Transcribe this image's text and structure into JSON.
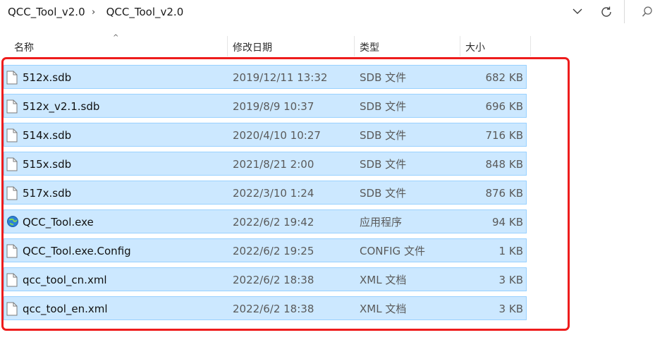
{
  "breadcrumb": {
    "items": [
      "QCC_Tool_v2.0",
      "QCC_Tool_v2.0"
    ],
    "separator": "›"
  },
  "toolbar": {
    "dropdown_icon": "chevron-down-icon",
    "refresh_icon": "refresh-icon",
    "search_icon": "search-icon"
  },
  "columns": {
    "name": "名称",
    "date": "修改日期",
    "type": "类型",
    "size": "大小",
    "sort_indicator": "^"
  },
  "files": [
    {
      "name": "512x.sdb",
      "date": "2019/12/11 13:32",
      "type": "SDB 文件",
      "size": "682 KB",
      "icon": "file-icon"
    },
    {
      "name": "512x_v2.1.sdb",
      "date": "2019/8/9 10:37",
      "type": "SDB 文件",
      "size": "696 KB",
      "icon": "file-icon"
    },
    {
      "name": "514x.sdb",
      "date": "2020/4/10 10:27",
      "type": "SDB 文件",
      "size": "716 KB",
      "icon": "file-icon"
    },
    {
      "name": "515x.sdb",
      "date": "2021/8/21 2:00",
      "type": "SDB 文件",
      "size": "848 KB",
      "icon": "file-icon"
    },
    {
      "name": "517x.sdb",
      "date": "2022/3/10 1:24",
      "type": "SDB 文件",
      "size": "876 KB",
      "icon": "file-icon"
    },
    {
      "name": "QCC_Tool.exe",
      "date": "2022/6/2 19:42",
      "type": "应用程序",
      "size": "94 KB",
      "icon": "application-icon"
    },
    {
      "name": "QCC_Tool.exe.Config",
      "date": "2022/6/2 19:25",
      "type": "CONFIG 文件",
      "size": "1 KB",
      "icon": "file-icon"
    },
    {
      "name": "qcc_tool_cn.xml",
      "date": "2022/6/2 18:38",
      "type": "XML 文档",
      "size": "3 KB",
      "icon": "file-icon"
    },
    {
      "name": "qcc_tool_en.xml",
      "date": "2022/6/2 18:38",
      "type": "XML 文档",
      "size": "3 KB",
      "icon": "file-icon"
    }
  ],
  "colors": {
    "selection_bg": "#cce8ff",
    "selection_border": "#99d1ff",
    "highlight_border": "#ee1c1c"
  }
}
